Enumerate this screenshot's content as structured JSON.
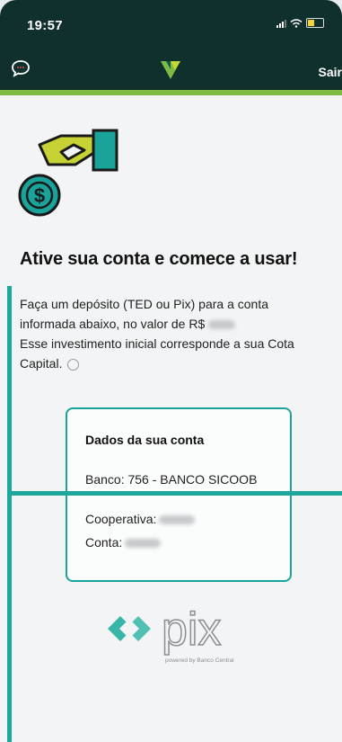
{
  "status": {
    "time": "19:57"
  },
  "nav": {
    "logout_label": "Sair",
    "chat_icon": "chat-bubble-icon",
    "logo_icon": "sicoob-logo"
  },
  "main": {
    "headline": "Ative sua conta e comece a usar!",
    "desc_line1": "Faça um depósito (TED ou Pix) para a conta",
    "desc_line2": "informada abaixo, no valor de R$",
    "desc_line3": "Esse investimento inicial corresponde a sua Cota",
    "desc_line4": "Capital."
  },
  "account_card": {
    "title": "Dados da sua conta",
    "bank": "Banco: 756 - BANCO SICOOB",
    "cooperative_label": "Cooperativa:",
    "account_label": "Conta:"
  },
  "pix": {
    "wordmark": "pix",
    "tagline": "powered by Banco Central"
  },
  "colors": {
    "header": "#0f302d",
    "accent_green": "#7dbb42",
    "teal": "#1ea79c",
    "background": "#f2f4f5"
  }
}
